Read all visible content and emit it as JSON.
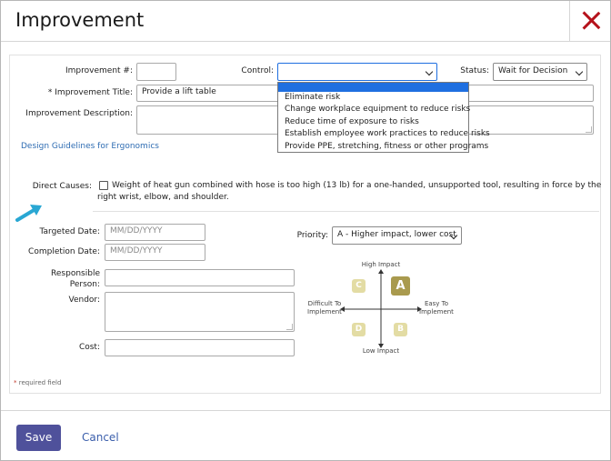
{
  "modal": {
    "title": "Improvement"
  },
  "form": {
    "improvement_number": {
      "label": "Improvement #:",
      "value": ""
    },
    "control": {
      "label": "Control:",
      "value": ""
    },
    "status": {
      "label": "Status:",
      "value": "Wait for Decision"
    },
    "title": {
      "label": "* Improvement Title:",
      "value": "Provide a lift table"
    },
    "description": {
      "label": "Improvement Description:",
      "value": ""
    },
    "design_link": "Design Guidelines for Ergonomics",
    "direct_causes": {
      "label": "Direct Causes:",
      "line1": "Weight of heat gun combined with hose is too high (13 lb) for a one-handed, unsupported tool, resulting in force by the",
      "line2": "right wrist, elbow, and shoulder.",
      "checked": false
    },
    "targeted_date": {
      "label": "Targeted Date:",
      "placeholder": "MM/DD/YYYY"
    },
    "completion_date": {
      "label": "Completion Date:",
      "placeholder": "MM/DD/YYYY"
    },
    "responsible": {
      "label_line1": "Responsible",
      "label_line2": "Person:",
      "value": ""
    },
    "vendor": {
      "label": "Vendor:",
      "value": ""
    },
    "cost": {
      "label": "Cost:",
      "value": ""
    },
    "priority": {
      "label": "Priority:",
      "value": "A - Higher impact, lower cost"
    }
  },
  "control_dropdown": {
    "options": [
      "Eliminate risk",
      "Change workplace equipment to reduce risks",
      "Reduce time of exposure to risks",
      "Establish employee work practices to reduce risks",
      "Provide PPE, stretching, fitness or other programs"
    ]
  },
  "priority_chart": {
    "high": "High Impact",
    "low": "Low Impact",
    "difficult_line1": "Difficult To",
    "difficult_line2": "Implement",
    "easy_line1": "Easy To",
    "easy_line2": "Implement",
    "quadrants": {
      "a": "A",
      "b": "B",
      "c": "C",
      "d": "D"
    },
    "colors": {
      "selected": "#a99a4e",
      "unselected": "#e3dca4"
    }
  },
  "required_note": {
    "star": "*",
    "text": "required field"
  },
  "footer": {
    "save": "Save",
    "cancel": "Cancel"
  },
  "colors": {
    "save_button": "#4f519b",
    "close_icon": "#b5121b",
    "dropdown_highlight": "#1f6fe0",
    "arrow": "#29a7d3",
    "link": "#2f6db3"
  }
}
